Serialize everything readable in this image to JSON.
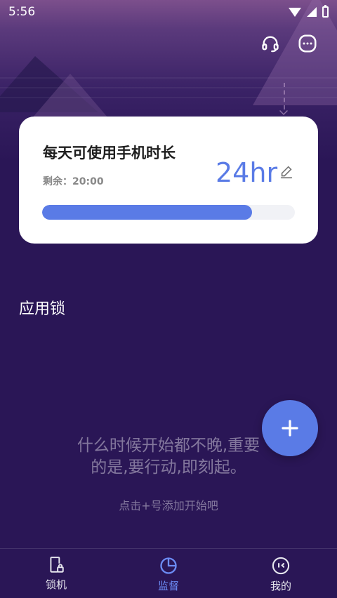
{
  "status_bar": {
    "time": "5:56"
  },
  "header": {
    "support_icon": "headset-icon",
    "more_icon": "chat-more-icon"
  },
  "card": {
    "title": "每天可使用手机时长",
    "remaining": "剩余：20:00",
    "hours": "24hr",
    "progress_fraction": 0.83,
    "accent_color": "#5a7be6"
  },
  "section": {
    "title": "应用锁"
  },
  "empty_state": {
    "quote_line1": "什么时候开始都不晚,重要",
    "quote_line2": "的是,要行动,即刻起。",
    "hint": "点击+号添加开始吧"
  },
  "fab": {
    "icon": "plus-icon"
  },
  "bottom_nav": {
    "items": [
      {
        "label": "锁机",
        "icon": "phone-lock-icon"
      },
      {
        "label": "监督",
        "icon": "pie-chart-icon",
        "active": true
      },
      {
        "label": "我的",
        "icon": "face-icon"
      }
    ]
  }
}
